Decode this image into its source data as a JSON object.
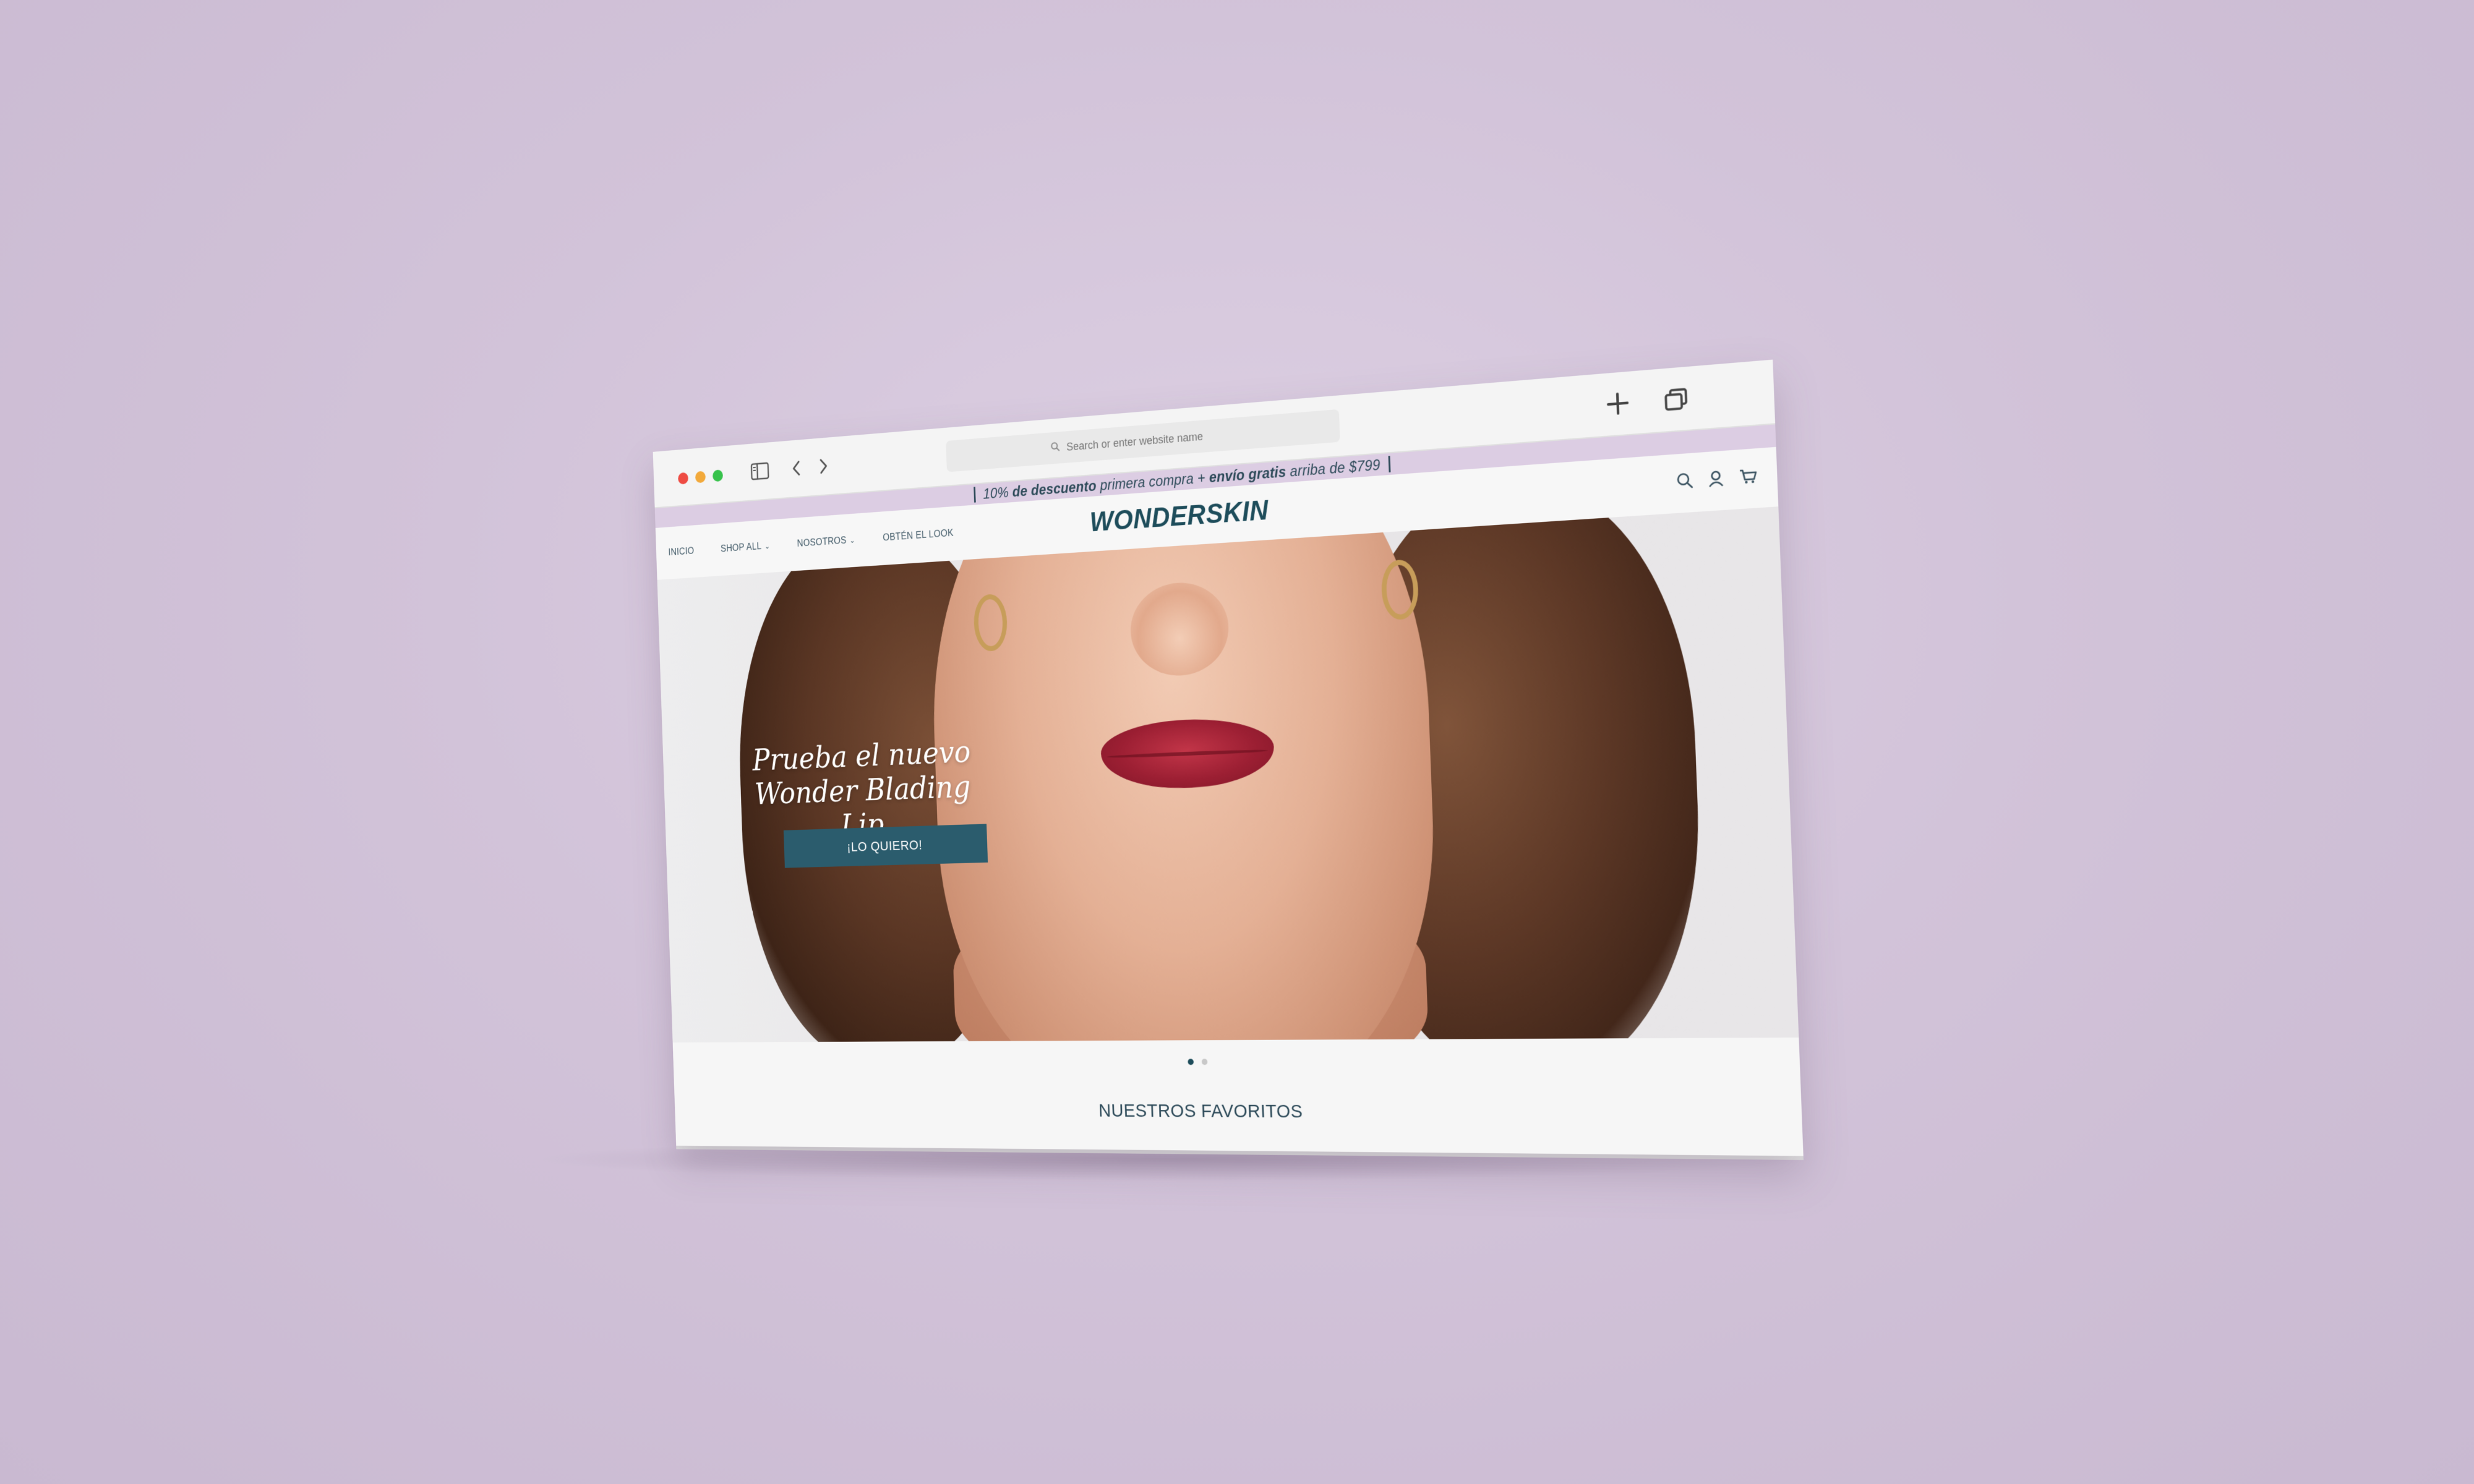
{
  "browser": {
    "search_placeholder": "Search or enter website name",
    "icons": [
      "sidebar-icon",
      "back-icon",
      "forward-icon",
      "search-icon",
      "new-tab-icon",
      "tabs-overview-icon"
    ]
  },
  "announcement": {
    "part1": "10%",
    "part2": "de descuento",
    "part3": "primera compra +",
    "part4": "envío gratis",
    "part5": "arriba de $799"
  },
  "header": {
    "logo": "WONDERSKIN",
    "nav": [
      {
        "label": "INICIO"
      },
      {
        "label": "SHOP ALL"
      },
      {
        "label": "NOSOTROS"
      },
      {
        "label": "OBTÉN EL LOOK"
      }
    ]
  },
  "hero": {
    "line1": "Prueba el nuevo",
    "line2": "Wonder Blading Lip",
    "cta": "¡LO QUIERO!"
  },
  "carousel": {
    "slides": 2,
    "active": 1
  },
  "section": {
    "title": "NUESTROS FAVORITOS"
  },
  "colors": {
    "brand": "#1e4d5b",
    "cta": "#2b5c6d",
    "announcement_bg": "#dccde3",
    "background": "#d2c3d9"
  }
}
